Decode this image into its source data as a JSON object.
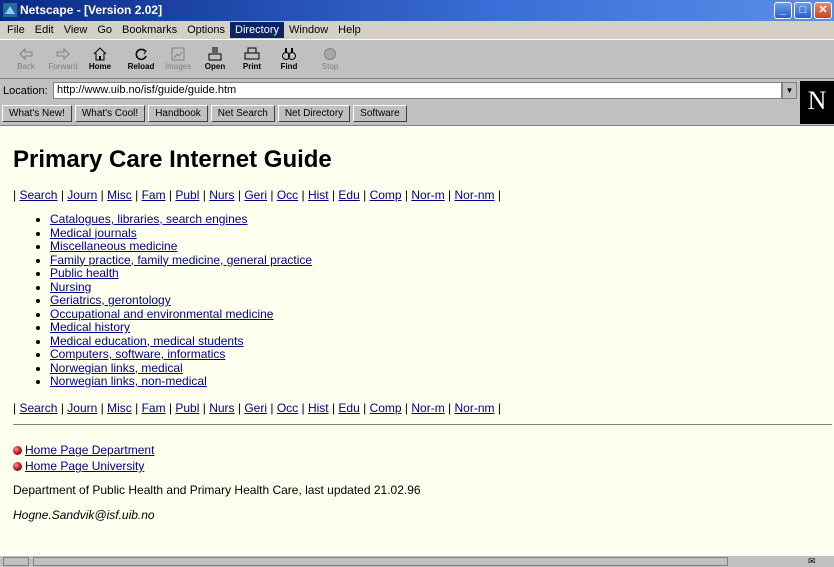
{
  "window": {
    "title": "Netscape - [Version 2.02]"
  },
  "menubar": [
    "File",
    "Edit",
    "View",
    "Go",
    "Bookmarks",
    "Options",
    "Directory",
    "Window",
    "Help"
  ],
  "toolbar": {
    "back": "Back",
    "forward": "Forward",
    "home": "Home",
    "reload": "Reload",
    "images": "Images",
    "open": "Open",
    "print": "Print",
    "find": "Find",
    "stop": "Stop"
  },
  "location": {
    "label": "Location:",
    "url": "http://www.uib.no/isf/guide/guide.htm"
  },
  "logo": "N",
  "directory_buttons": [
    "What's New!",
    "What's Cool!",
    "Handbook",
    "Net Search",
    "Net Directory",
    "Software"
  ],
  "page": {
    "title": "Primary Care Internet Guide",
    "nav": [
      "Search",
      "Journ",
      "Misc",
      "Fam",
      "Publ",
      "Nurs",
      "Geri",
      "Occ",
      "Hist",
      "Edu",
      "Comp",
      "Nor-m",
      "Nor-nm"
    ],
    "topics": [
      "Catalogues, libraries, search engines",
      "Medical journals",
      "Miscellaneous medicine",
      "Family practice, family medicine, general practice",
      "Public health",
      "Nursing",
      "Geriatrics, gerontology",
      "Occupational and environmental medicine",
      "Medical history",
      "Medical education, medical students",
      "Computers, software, informatics",
      "Norwegian links, medical",
      "Norwegian links, non-medical"
    ],
    "home_links": [
      "Home Page Department",
      "Home Page University"
    ],
    "department_line": "Department of Public Health and Primary Health Care, last updated 21.02.96",
    "email": "Hogne.Sandvik@isf.uib.no"
  }
}
